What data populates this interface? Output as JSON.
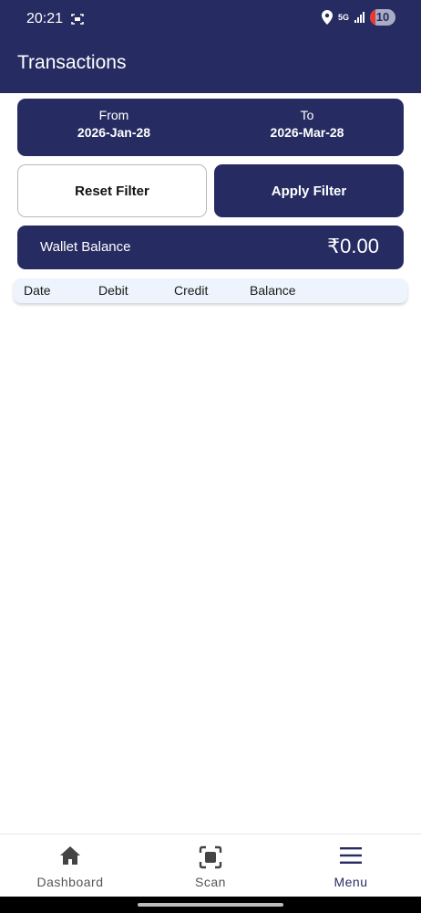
{
  "status_bar": {
    "time": "20:21",
    "network": "5G",
    "battery": "10"
  },
  "app_bar": {
    "title": "Transactions"
  },
  "date_filter": {
    "from_label": "From",
    "from_value": "2026-Jan-28",
    "to_label": "To",
    "to_value": "2026-Mar-28"
  },
  "buttons": {
    "reset_label": "Reset Filter",
    "apply_label": "Apply Filter"
  },
  "wallet": {
    "label": "Wallet Balance",
    "amount": "₹0.00"
  },
  "table": {
    "columns": [
      "Date",
      "Debit",
      "Credit",
      "Balance"
    ],
    "rows": []
  },
  "bottom_nav": {
    "items": [
      {
        "label": "Dashboard",
        "icon": "home-icon"
      },
      {
        "label": "Scan",
        "icon": "scan-icon"
      },
      {
        "label": "Menu",
        "icon": "menu-icon",
        "active": true
      }
    ]
  },
  "colors": {
    "primary": "#262c62",
    "table_header_bg": "#eef4fd"
  }
}
